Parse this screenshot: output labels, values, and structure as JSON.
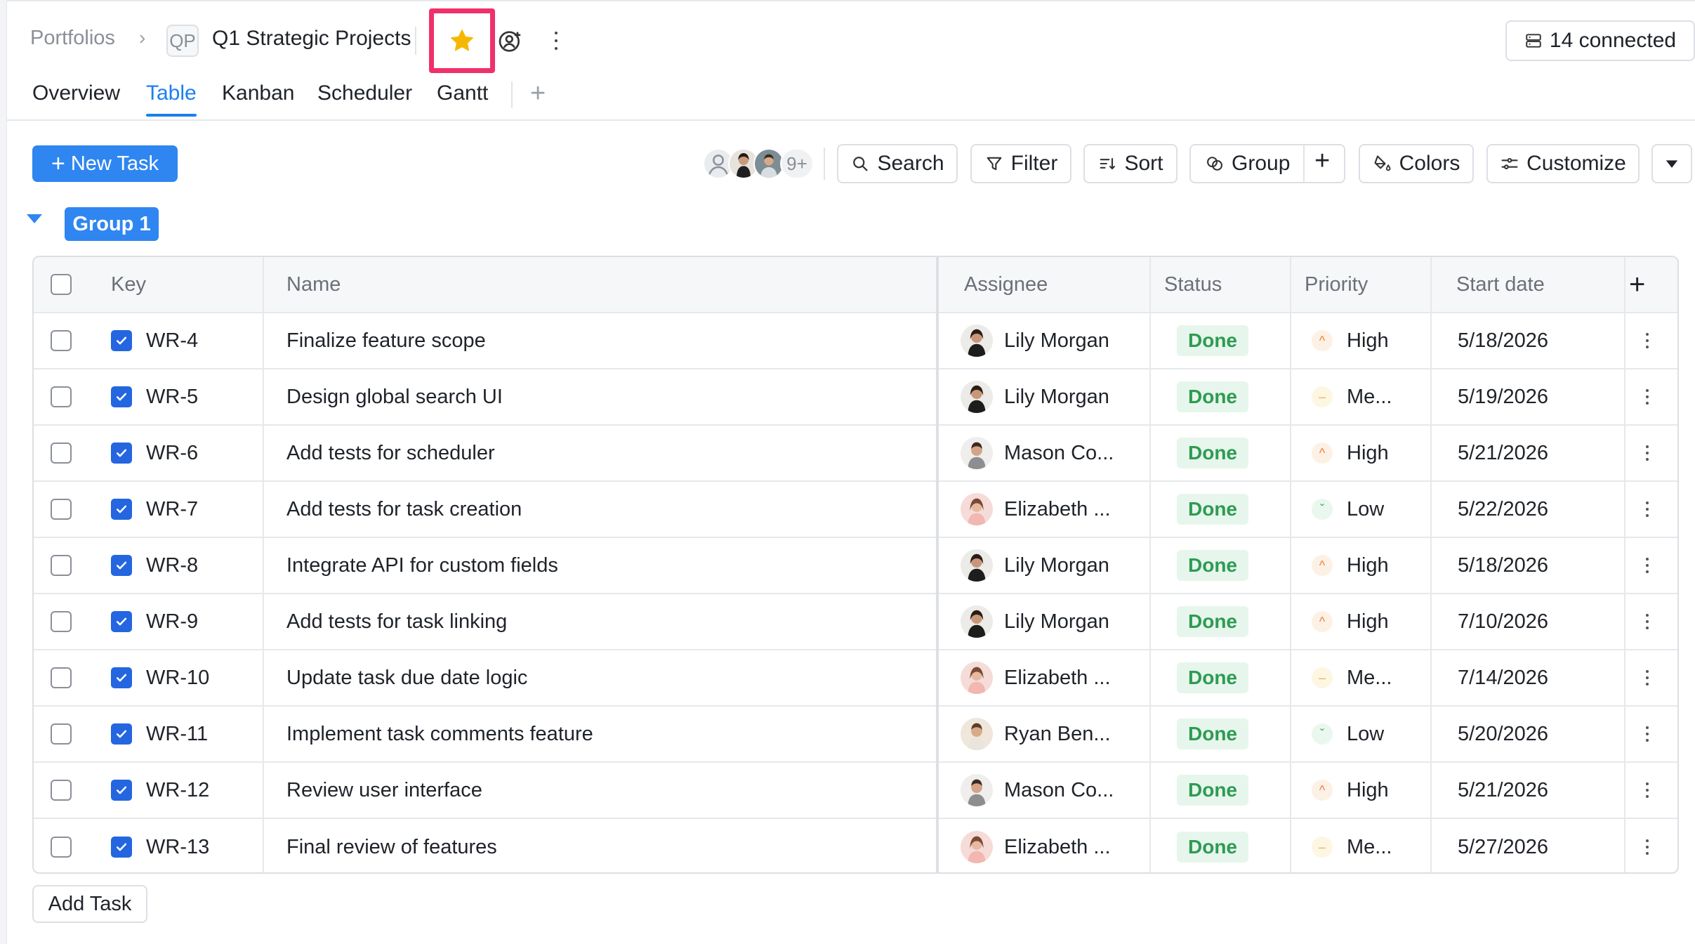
{
  "breadcrumb": {
    "root": "Portfolios",
    "separator": "›",
    "project_badge": "QP",
    "project_title": "Q1 Strategic Projects"
  },
  "header": {
    "connected_label": "14 connected",
    "favorite_starred": true
  },
  "tabs": [
    {
      "label": "Overview",
      "active": false
    },
    {
      "label": "Table",
      "active": true
    },
    {
      "label": "Kanban",
      "active": false
    },
    {
      "label": "Scheduler",
      "active": false
    },
    {
      "label": "Gantt",
      "active": false
    }
  ],
  "tab_add_label": "+",
  "toolbar": {
    "new_task_label": "New Task",
    "avatars_more": "9+",
    "search_label": "Search",
    "filter_label": "Filter",
    "sort_label": "Sort",
    "group_label": "Group",
    "group_add_label": "+",
    "colors_label": "Colors",
    "customize_label": "Customize"
  },
  "group": {
    "label": "Group 1"
  },
  "table": {
    "columns": {
      "key": "Key",
      "name": "Name",
      "assignee": "Assignee",
      "status": "Status",
      "priority": "Priority",
      "start_date": "Start date",
      "add": "+"
    },
    "rows": [
      {
        "key": "WR-4",
        "name": "Finalize feature scope",
        "assignee": "Lily Morgan",
        "avatar": "lily",
        "status": "Done",
        "priority": "High",
        "prio_level": "high",
        "start_date": "5/18/2026"
      },
      {
        "key": "WR-5",
        "name": "Design global search UI",
        "assignee": "Lily Morgan",
        "avatar": "lily",
        "status": "Done",
        "priority": "Me...",
        "prio_level": "med",
        "start_date": "5/19/2026"
      },
      {
        "key": "WR-6",
        "name": "Add tests for scheduler",
        "assignee": "Mason Co...",
        "avatar": "mason",
        "status": "Done",
        "priority": "High",
        "prio_level": "high",
        "start_date": "5/21/2026"
      },
      {
        "key": "WR-7",
        "name": "Add tests for task creation",
        "assignee": "Elizabeth ...",
        "avatar": "elizabeth",
        "status": "Done",
        "priority": "Low",
        "prio_level": "low",
        "start_date": "5/22/2026"
      },
      {
        "key": "WR-8",
        "name": "Integrate API for custom fields",
        "assignee": "Lily Morgan",
        "avatar": "lily",
        "status": "Done",
        "priority": "High",
        "prio_level": "high",
        "start_date": "5/18/2026"
      },
      {
        "key": "WR-9",
        "name": "Add tests for task linking",
        "assignee": "Lily Morgan",
        "avatar": "lily",
        "status": "Done",
        "priority": "High",
        "prio_level": "high",
        "start_date": "7/10/2026"
      },
      {
        "key": "WR-10",
        "name": "Update task due date logic",
        "assignee": "Elizabeth ...",
        "avatar": "elizabeth",
        "status": "Done",
        "priority": "Me...",
        "prio_level": "med",
        "start_date": "7/14/2026"
      },
      {
        "key": "WR-11",
        "name": "Implement task comments feature",
        "assignee": "Ryan Ben...",
        "avatar": "ryan",
        "status": "Done",
        "priority": "Low",
        "prio_level": "low",
        "start_date": "5/20/2026"
      },
      {
        "key": "WR-12",
        "name": "Review user interface",
        "assignee": "Mason Co...",
        "avatar": "mason",
        "status": "Done",
        "priority": "High",
        "prio_level": "high",
        "start_date": "5/21/2026"
      },
      {
        "key": "WR-13",
        "name": "Final review of features",
        "assignee": "Elizabeth ...",
        "avatar": "elizabeth",
        "status": "Done",
        "priority": "Me...",
        "prio_level": "med",
        "start_date": "5/27/2026"
      }
    ]
  },
  "footer": {
    "add_task_label": "Add Task"
  },
  "colors": {
    "accent": "#2f86f0",
    "star": "#f5b800",
    "highlight": "#f0306a",
    "done_bg": "#e7f6ec",
    "done_text": "#2e9b53"
  }
}
